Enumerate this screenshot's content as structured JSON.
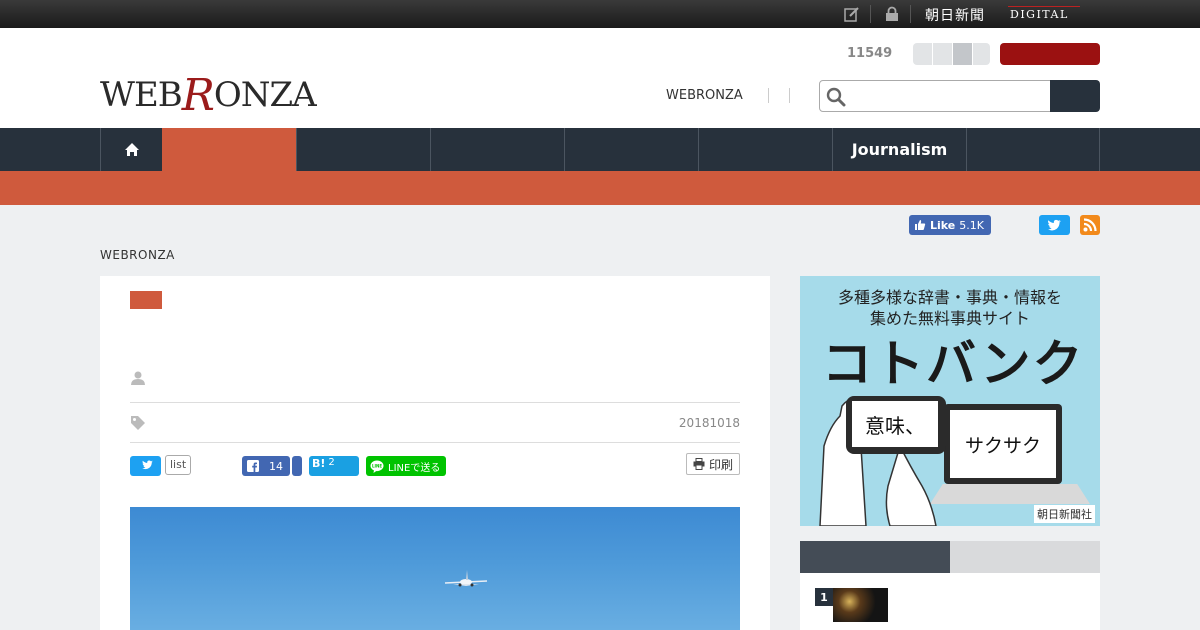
{
  "topbar": {
    "brand_jp": "朝日新聞",
    "brand_digital": "DIGITAL"
  },
  "header": {
    "logo_pre": "WEB",
    "logo_r": "R",
    "logo_post": "ONZA",
    "count": "11549",
    "link_webronza": "WEBRONZA",
    "search": {
      "placeholder": ""
    }
  },
  "nav": {
    "items": [
      {
        "label": ""
      },
      {
        "label": ""
      },
      {
        "label": ""
      },
      {
        "label": ""
      },
      {
        "label": ""
      },
      {
        "label": "Journalism"
      },
      {
        "label": ""
      }
    ]
  },
  "social": {
    "fb_like_label": "Like",
    "fb_like_count": "5.1K"
  },
  "breadcrumb": "WEBRONZA",
  "article": {
    "date": "20181018",
    "twitter_count": "list",
    "fb_share_count": "14",
    "hatena_label": "B!",
    "hatena_count": "2",
    "line_label": "LINEで送る",
    "print_label": "印刷"
  },
  "ad": {
    "line1": "多種多様な辞書・事典・情報を",
    "line2": "集めた無料事典サイト",
    "title": "コトバンク",
    "phone_text": "意味、",
    "laptop_text": "サクサク",
    "brand": "朝日新聞社"
  },
  "ranking": {
    "items": [
      {
        "rank": "1"
      }
    ]
  },
  "colors": {
    "nav_bg": "#27313c",
    "accent": "#cf5a3d",
    "brand_red": "#9b1111",
    "ad_bg": "#a6dbea"
  }
}
